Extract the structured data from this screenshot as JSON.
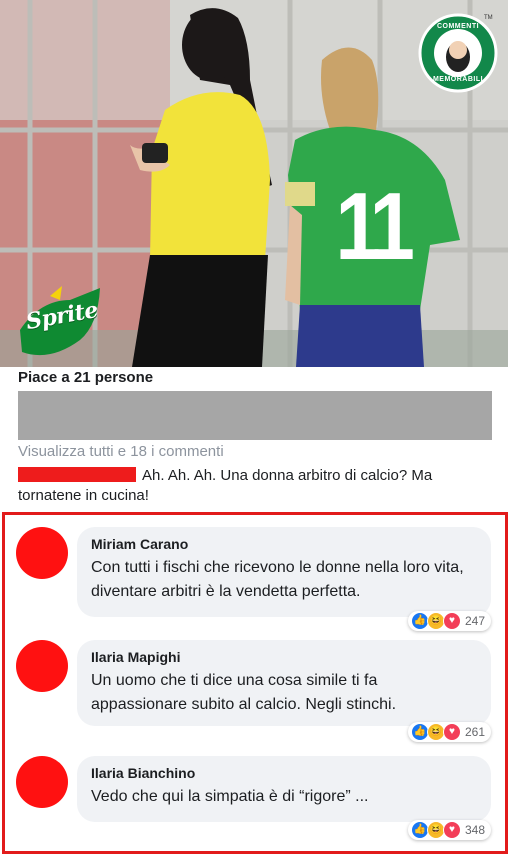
{
  "post": {
    "likes_text": "Piace a 21 persone",
    "view_comments": "Visualizza tutti e 18 i commenti",
    "quoted_comment": "Ah. Ah. Ah. Una donna arbitro di calcio? Ma tornatene in cucina!"
  },
  "photo": {
    "jersey_number": "11",
    "sprite_logo": "Sprite",
    "badge_top": "COMMENTI",
    "badge_bottom": "MEMORABILI",
    "trademark": "TM"
  },
  "replies": [
    {
      "author": "Miriam Carano",
      "text": "Con tutti i fischi che ricevono le donne nella loro vita, diventare arbitri è la vendetta perfetta.",
      "reactions": [
        "like-icon",
        "haha-icon",
        "love-icon"
      ],
      "count": "247"
    },
    {
      "author": "Ilaria Mapighi",
      "text": "Un uomo che ti dice una cosa simile ti fa appassionare subito al calcio. Negli stinchi.",
      "reactions": [
        "like-icon",
        "haha-icon",
        "love-icon"
      ],
      "count": "261"
    },
    {
      "author": "Ilaria Bianchino",
      "text": "Vedo che qui la simpatia è di “rigore” ...",
      "reactions": [
        "like-icon",
        "haha-icon",
        "love-icon"
      ],
      "count": "348"
    }
  ],
  "colors": {
    "highlight_border": "#e21b1b",
    "avatar": "#ff1111",
    "bubble": "#f0f2f5",
    "referee_shirt": "#f2e33a",
    "player_jersey": "#2fa84b"
  }
}
